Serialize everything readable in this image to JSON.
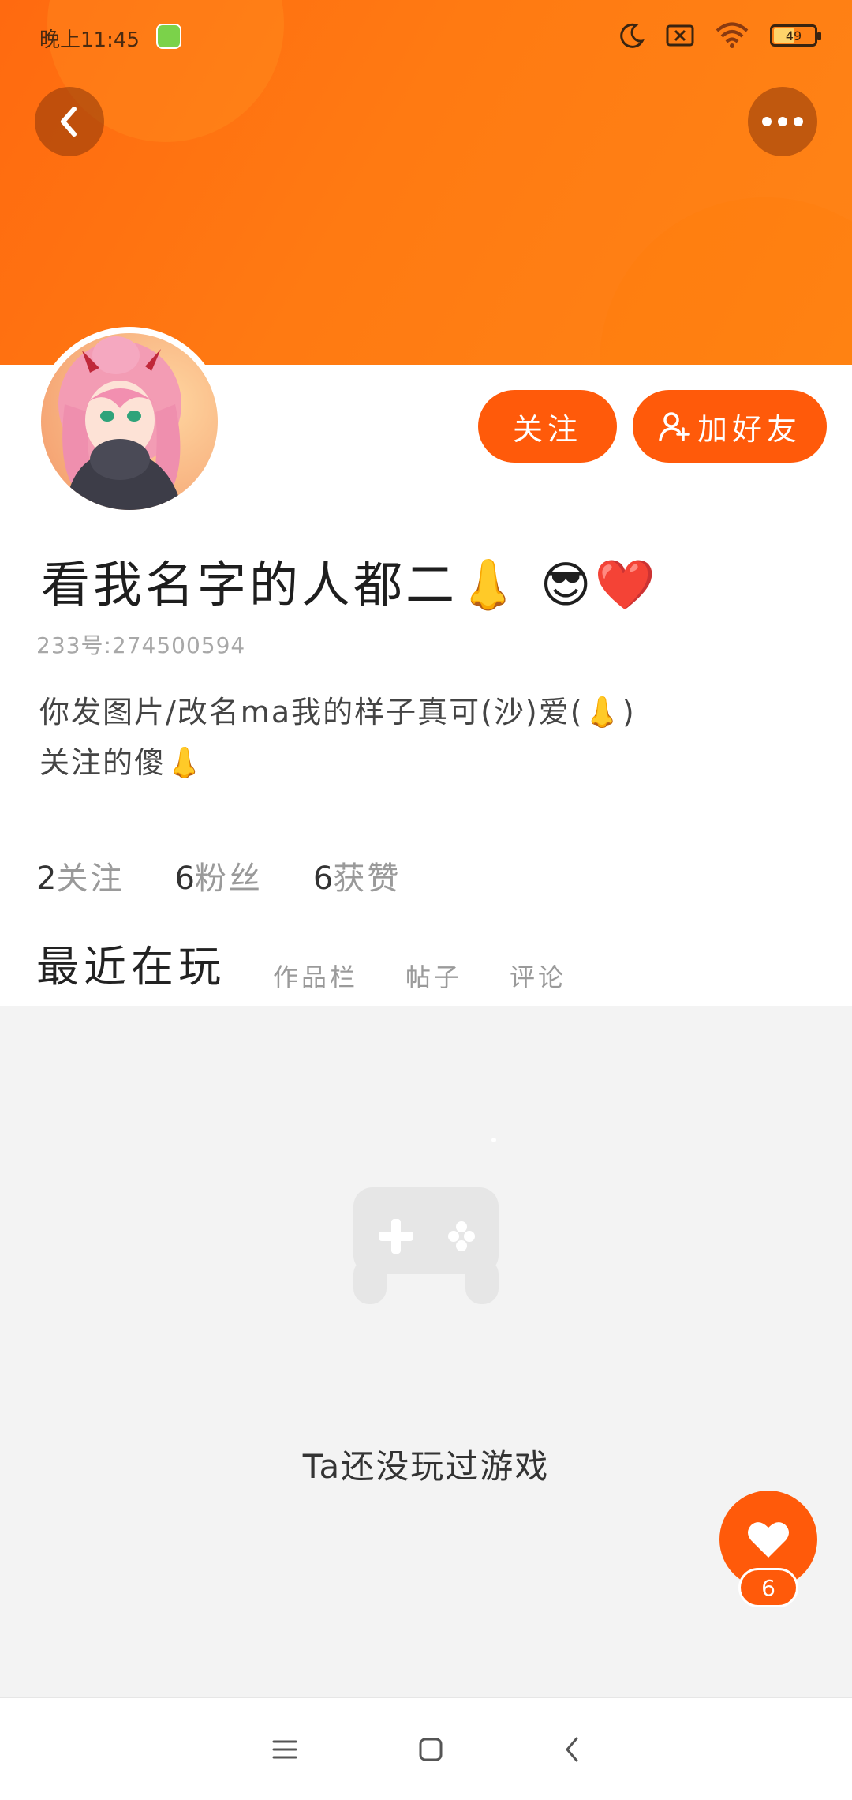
{
  "status_bar": {
    "time": "晚上11:45",
    "battery_level": "49",
    "icons": [
      "moon-icon",
      "sim-off-icon",
      "wifi-icon",
      "battery-icon"
    ]
  },
  "header": {
    "back_icon": "chevron-left-icon",
    "more_icon": "more-dots-icon"
  },
  "profile": {
    "follow_label": "关注",
    "add_friend_label": "加好友",
    "username": "看我名字的人都二👃 😎❤️",
    "uid": "233号:274500594",
    "bio_line1": "你发图片/改名ma我的样子真可(沙)爱(👃)",
    "bio_line2": "关注的傻👃"
  },
  "stats": [
    {
      "value": "2",
      "label": "关注"
    },
    {
      "value": "6",
      "label": "粉丝"
    },
    {
      "value": "6",
      "label": "获赞"
    }
  ],
  "tabs": [
    {
      "label": "最近在玩",
      "active": true
    },
    {
      "label": "作品栏",
      "active": false
    },
    {
      "label": "帖子",
      "active": false
    },
    {
      "label": "评论",
      "active": false
    }
  ],
  "empty_state": {
    "icon": "gamepad-icon",
    "text": "Ta还没玩过游戏"
  },
  "like_fab": {
    "icon": "heart-icon",
    "count": "6"
  },
  "nav_bar": {
    "items": [
      "menu-icon",
      "home-square-icon",
      "back-chevron-icon"
    ]
  },
  "colors": {
    "accent": "#ff5a0a",
    "banner": "#ff7a12",
    "content_bg": "#f3f3f3"
  }
}
